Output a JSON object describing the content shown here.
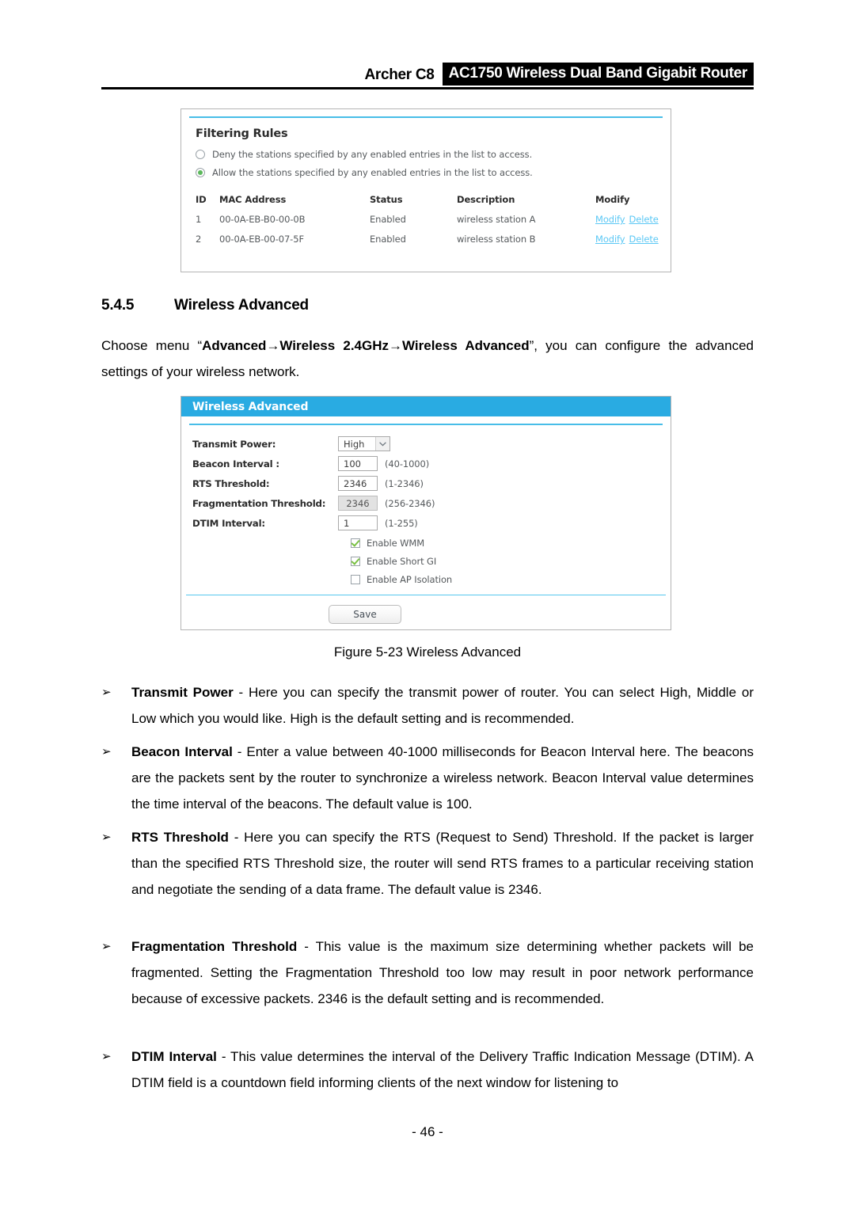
{
  "header": {
    "model": "Archer C8",
    "product": "AC1750 Wireless Dual Band Gigabit Router"
  },
  "filtering_panel": {
    "title": "Filtering Rules",
    "options": [
      {
        "label": "Deny the stations specified by any enabled entries in the list to access.",
        "selected": false
      },
      {
        "label": "Allow the stations specified by any enabled entries in the list to access.",
        "selected": true
      }
    ],
    "table": {
      "columns": [
        "ID",
        "MAC Address",
        "Status",
        "Description",
        "Modify"
      ],
      "rows": [
        {
          "id": "1",
          "mac": "00-0A-EB-B0-00-0B",
          "status": "Enabled",
          "description": "wireless station A",
          "modify": "Modify",
          "delete": "Delete"
        },
        {
          "id": "2",
          "mac": "00-0A-EB-00-07-5F",
          "status": "Enabled",
          "description": "wireless station B",
          "modify": "Modify",
          "delete": "Delete"
        }
      ]
    }
  },
  "section": {
    "number": "5.4.5",
    "title": "Wireless Advanced",
    "intro_html": "Choose menu &#8220;<b>Advanced</b>&#8594;<b>Wireless 2.4GHz</b>&#8594;<b>Wireless Advanced</b>&#8221;, you can configure the advanced settings of your wireless network."
  },
  "advanced_panel": {
    "title": "Wireless Advanced",
    "fields": [
      {
        "label": "Transmit Power:",
        "type": "select",
        "value": "High",
        "hint": "",
        "disabled": false
      },
      {
        "label": "Beacon Interval :",
        "type": "text",
        "value": "100",
        "hint": "(40-1000)",
        "disabled": false
      },
      {
        "label": "RTS Threshold:",
        "type": "text",
        "value": "2346",
        "hint": "(1-2346)",
        "disabled": false
      },
      {
        "label": "Fragmentation Threshold:",
        "type": "text",
        "value": "2346",
        "hint": "(256-2346)",
        "disabled": true
      },
      {
        "label": "DTIM Interval:",
        "type": "text",
        "value": "1",
        "hint": "(1-255)",
        "disabled": false
      }
    ],
    "checkboxes": [
      {
        "label": "Enable WMM",
        "checked": true
      },
      {
        "label": "Enable Short GI",
        "checked": true
      },
      {
        "label": "Enable AP Isolation",
        "checked": false
      }
    ],
    "save_label": "Save",
    "accent_color": "#29abe2",
    "link_color": "#5bc8f5",
    "check_color": "#7ac143"
  },
  "figure_caption": "Figure 5-23 Wireless Advanced",
  "bullets": [
    {
      "term": "Transmit Power",
      "body": " - Here you can specify the transmit power of router. You can select High, Middle or Low which you would like. High is the default setting and is recommended."
    },
    {
      "term": "Beacon Interval",
      "body": " - Enter a value between 40-1000 milliseconds for Beacon Interval here. The beacons are the packets sent by the router to synchronize a wireless network. Beacon Interval value determines the time interval of the beacons. The default value is 100."
    },
    {
      "term": "RTS Threshold",
      "body": " - Here you can specify the RTS (Request to Send) Threshold. If the packet is larger than the specified RTS Threshold size, the router will send RTS frames to a particular receiving station and negotiate the sending of a data frame. The default value is 2346."
    },
    {
      "term": "Fragmentation Threshold",
      "body": " - This value is the maximum size determining whether packets will be fragmented. Setting the Fragmentation Threshold too low may result in poor network performance because of excessive packets. 2346 is the default setting and is recommended."
    },
    {
      "term": "DTIM Interval",
      "body": " - This value determines the interval of the Delivery Traffic Indication Message (DTIM). A DTIM field is a countdown field informing clients of the next window for listening to"
    }
  ],
  "bullet_marker": "➢",
  "footer": "- 46 -"
}
